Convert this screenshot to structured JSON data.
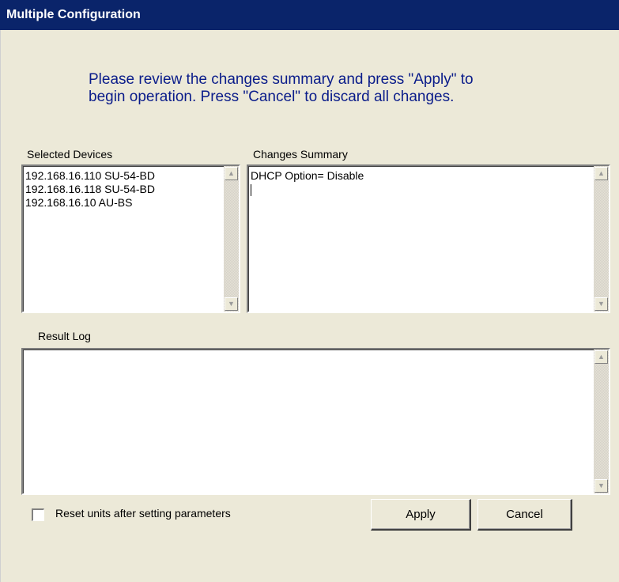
{
  "window": {
    "title": "Multiple Configuration"
  },
  "intro": {
    "text": "Please review the changes summary and press \"Apply\" to\nbegin operation.  Press \"Cancel\" to discard all changes."
  },
  "selected_devices": {
    "label": "Selected Devices",
    "items": [
      "192.168.16.110 SU-54-BD",
      "192.168.16.118 SU-54-BD",
      "192.168.16.10 AU-BS"
    ]
  },
  "changes_summary": {
    "label": "Changes Summary",
    "lines": [
      "DHCP Option= Disable"
    ]
  },
  "result_log": {
    "label": "Result Log",
    "lines": []
  },
  "reset_option": {
    "label": "Reset units after setting parameters",
    "checked": false
  },
  "buttons": {
    "apply": "Apply",
    "cancel": "Cancel"
  },
  "icons": {
    "scroll_up": "scroll-up-arrow-icon",
    "scroll_down": "scroll-down-arrow-icon"
  }
}
